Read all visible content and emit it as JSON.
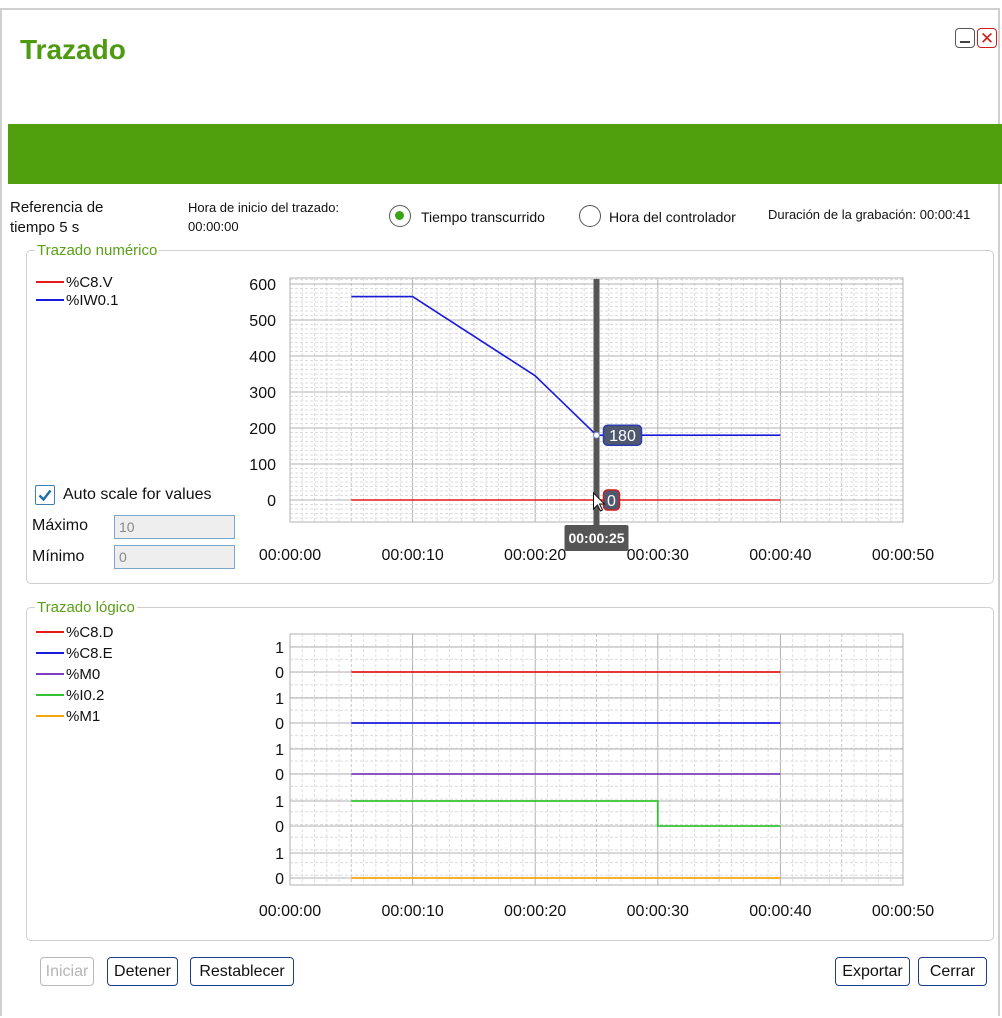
{
  "window": {
    "title": "Trazado",
    "minimize_icon": "minimize-icon",
    "close_icon": "close-icon"
  },
  "colors": {
    "accent": "#4fa00c",
    "title": "#4e9a12",
    "legend_text": "#5a9f16",
    "cursor": "#555555"
  },
  "header": {
    "time_reference_line1": "Referencia de",
    "time_reference_line2": "tiempo 5 s",
    "trace_start_label": "Hora de inicio del trazado:",
    "trace_start_value": "00:00:00",
    "radio_elapsed": "Tiempo transcurrido",
    "radio_controller": "Hora del controlador",
    "selected_radio": "Tiempo transcurrido",
    "recording_duration": "Duración de la grabación: 00:00:41"
  },
  "numeric": {
    "group_label": "Trazado numérico",
    "auto_scale_label": "Auto scale for values",
    "auto_scale_checked": true,
    "max_label": "Máximo",
    "max_value": "10",
    "min_label": "Mínimo",
    "min_value": "0",
    "cursor_time": "00:00:25",
    "cursor_values": [
      "180",
      "0"
    ]
  },
  "logic": {
    "group_label": "Trazado lógico"
  },
  "buttons": {
    "start": "Iniciar",
    "stop": "Detener",
    "reset": "Restablecer",
    "export": "Exportar",
    "close": "Cerrar"
  },
  "chart_data": [
    {
      "type": "line",
      "name_group": "Trazado numérico",
      "x_ticks": [
        "00:00:00",
        "00:00:10",
        "00:00:20",
        "00:00:30",
        "00:00:40",
        "00:00:50"
      ],
      "xlim": [
        0,
        50
      ],
      "ylim": [
        0,
        600
      ],
      "y_ticks": [
        0,
        100,
        200,
        300,
        400,
        500,
        600
      ],
      "grid": true,
      "legend_position": "top-left",
      "series": [
        {
          "name": "%C8.V",
          "color": "#e41a1c",
          "points": [
            [
              5,
              0
            ],
            [
              40,
              0
            ]
          ]
        },
        {
          "name": "%IW0.1",
          "color": "#1a1adb",
          "points": [
            [
              5,
              565
            ],
            [
              10,
              565
            ],
            [
              20,
              345
            ],
            [
              25,
              180
            ],
            [
              40,
              180
            ]
          ]
        }
      ],
      "cursor": {
        "x": 25,
        "label": "00:00:25",
        "values": [
          180,
          0
        ]
      }
    },
    {
      "type": "line",
      "name_group": "Trazado lógico",
      "x_ticks": [
        "00:00:00",
        "00:00:10",
        "00:00:20",
        "00:00:30",
        "00:00:40",
        "00:00:50"
      ],
      "xlim": [
        0,
        50
      ],
      "y_ticks_per_lane": [
        0,
        1
      ],
      "grid": true,
      "legend_position": "top-left",
      "series": [
        {
          "name": "%C8.D",
          "color": "#e41a1c",
          "points": [
            [
              5,
              0
            ],
            [
              40,
              0
            ]
          ]
        },
        {
          "name": "%C8.E",
          "color": "#1a1adb",
          "points": [
            [
              5,
              0
            ],
            [
              40,
              0
            ]
          ]
        },
        {
          "name": "%M0",
          "color": "#7b3fbf",
          "points": [
            [
              5,
              0
            ],
            [
              40,
              0
            ]
          ]
        },
        {
          "name": "%I0.2",
          "color": "#33c233",
          "points": [
            [
              5,
              1
            ],
            [
              30,
              1
            ],
            [
              30,
              0
            ],
            [
              40,
              0
            ]
          ]
        },
        {
          "name": "%M1",
          "color": "#f5a50d",
          "points": [
            [
              5,
              0
            ],
            [
              40,
              0
            ]
          ]
        }
      ]
    }
  ]
}
